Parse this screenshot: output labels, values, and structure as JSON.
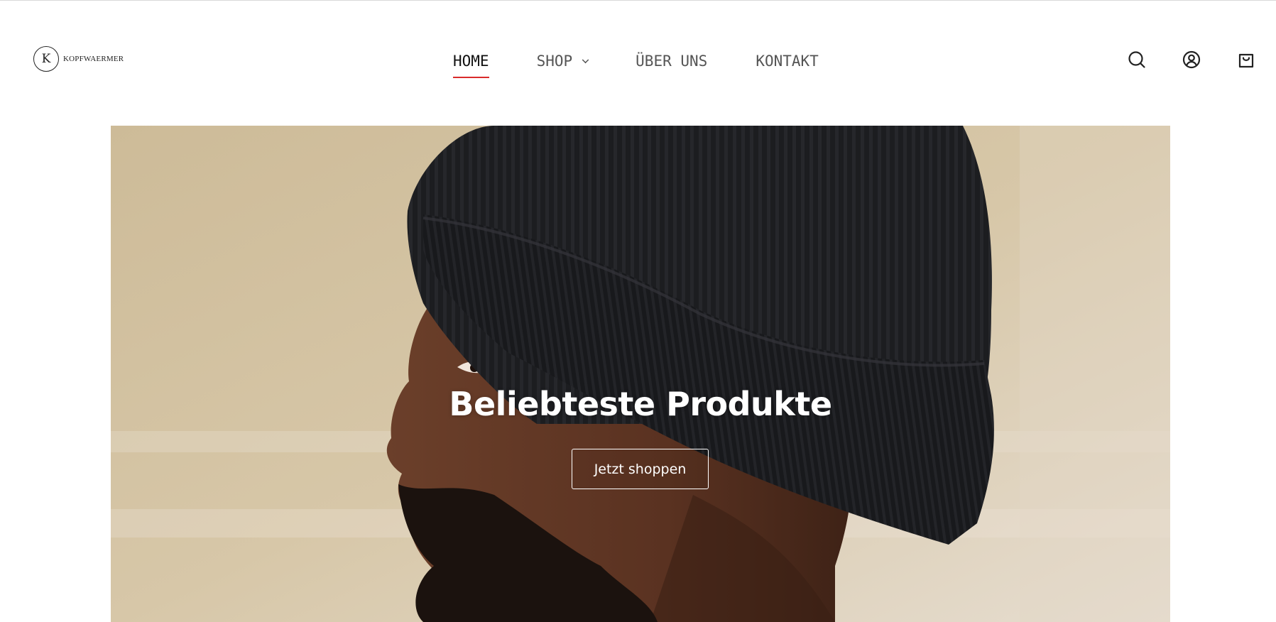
{
  "header": {
    "logo": {
      "mark": "K",
      "text": "KOPFWAERMER"
    },
    "nav": [
      {
        "label": "HOME",
        "active": true
      },
      {
        "label": "SHOP",
        "has_dropdown": true
      },
      {
        "label": "ÜBER UNS"
      },
      {
        "label": "KONTAKT"
      }
    ],
    "icons": [
      "search-icon",
      "account-icon",
      "cart-icon"
    ]
  },
  "hero": {
    "title": "Beliebteste Produkte",
    "button_label": "Jetzt shoppen"
  },
  "colors": {
    "accent_underline": "#d92b2b",
    "nav_text": "#555555",
    "nav_active_text": "#111111",
    "hero_text": "#ffffff"
  }
}
